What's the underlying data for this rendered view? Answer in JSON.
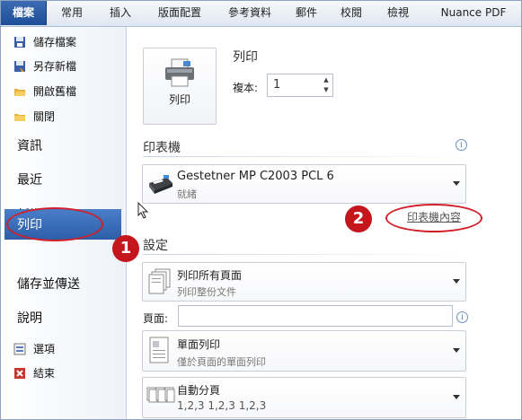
{
  "ribbon": {
    "tabs": [
      "檔案",
      "常用",
      "插入",
      "版面配置",
      "參考資料",
      "郵件",
      "校閱",
      "檢視",
      "Nuance PDF"
    ]
  },
  "nav": {
    "save": "儲存檔案",
    "save_as": "另存新檔",
    "open": "開啟舊檔",
    "close": "關閉",
    "info": "資訊",
    "recent": "最近",
    "new": "新增",
    "print": "列印",
    "save_send": "儲存並傳送",
    "help": "說明",
    "options": "選項",
    "exit": "結束"
  },
  "print": {
    "button_label": "列印",
    "title": "列印",
    "copies_label": "複本:",
    "copies_value": "1"
  },
  "printer": {
    "heading": "印表機",
    "name": "Gestetner MP C2003 PCL 6",
    "status": "就緒",
    "properties_link": "印表機內容"
  },
  "settings": {
    "heading": "設定",
    "range_title": "列印所有頁面",
    "range_sub": "列印整份文件",
    "pages_label": "頁面:",
    "pages_value": "",
    "sides_title": "單面列印",
    "sides_sub": "僅於頁面的單面列印",
    "collate_title": "自動分頁",
    "collate_sub": "1,2,3   1,2,3   1,2,3"
  },
  "annotations": {
    "badge_1": "1",
    "badge_2": "2",
    "color": "#d1202a"
  },
  "colors": {
    "file_tab": "#2a5ba4",
    "selected_nav": "#3a6cb8"
  }
}
